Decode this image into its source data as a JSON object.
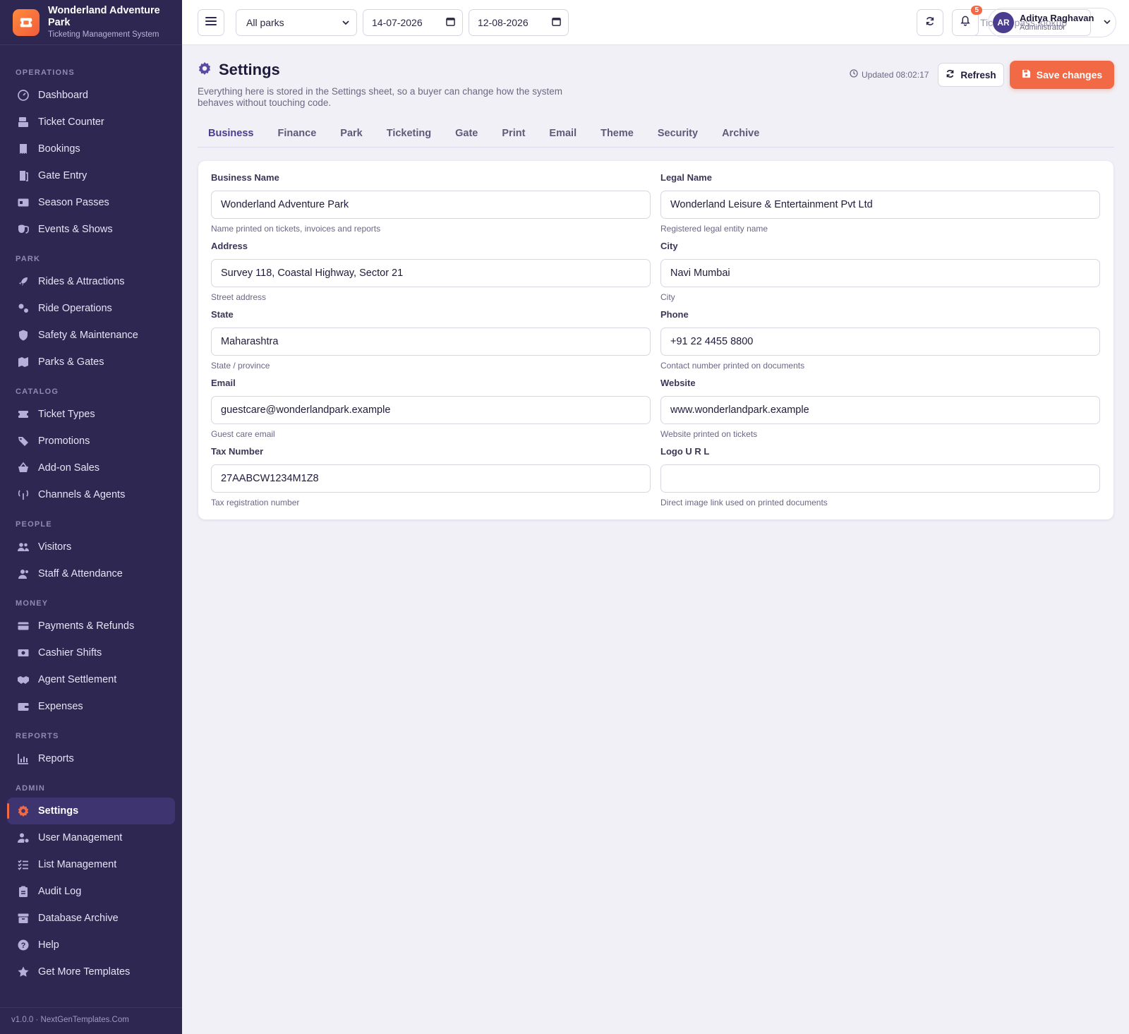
{
  "brand": {
    "name": "Wonderland Adventure Park",
    "subtitle": "Ticketing Management System"
  },
  "sidebar": {
    "sections": [
      {
        "title": "OPERATIONS",
        "items": [
          {
            "label": "Dashboard",
            "icon": "gauge-icon"
          },
          {
            "label": "Ticket Counter",
            "icon": "cash-register-icon"
          },
          {
            "label": "Bookings",
            "icon": "receipt-icon"
          },
          {
            "label": "Gate Entry",
            "icon": "door-icon"
          },
          {
            "label": "Season Passes",
            "icon": "id-card-icon"
          },
          {
            "label": "Events & Shows",
            "icon": "masks-icon"
          }
        ]
      },
      {
        "title": "PARK",
        "items": [
          {
            "label": "Rides & Attractions",
            "icon": "rocket-icon"
          },
          {
            "label": "Ride Operations",
            "icon": "gears-icon"
          },
          {
            "label": "Safety & Maintenance",
            "icon": "shield-icon"
          },
          {
            "label": "Parks & Gates",
            "icon": "map-icon"
          }
        ]
      },
      {
        "title": "CATALOG",
        "items": [
          {
            "label": "Ticket Types",
            "icon": "ticket-icon"
          },
          {
            "label": "Promotions",
            "icon": "tags-icon"
          },
          {
            "label": "Add-on Sales",
            "icon": "basket-icon"
          },
          {
            "label": "Channels & Agents",
            "icon": "antenna-icon"
          }
        ]
      },
      {
        "title": "PEOPLE",
        "items": [
          {
            "label": "Visitors",
            "icon": "users-icon"
          },
          {
            "label": "Staff & Attendance",
            "icon": "user-group-icon"
          }
        ]
      },
      {
        "title": "MONEY",
        "items": [
          {
            "label": "Payments & Refunds",
            "icon": "credit-card-icon"
          },
          {
            "label": "Cashier Shifts",
            "icon": "money-icon"
          },
          {
            "label": "Agent Settlement",
            "icon": "handshake-icon"
          },
          {
            "label": "Expenses",
            "icon": "wallet-icon"
          }
        ]
      },
      {
        "title": "REPORTS",
        "items": [
          {
            "label": "Reports",
            "icon": "bar-chart-icon"
          }
        ]
      },
      {
        "title": "ADMIN",
        "items": [
          {
            "label": "Settings",
            "icon": "gear-icon",
            "active": true
          },
          {
            "label": "User Management",
            "icon": "user-gear-icon"
          },
          {
            "label": "List Management",
            "icon": "list-check-icon"
          },
          {
            "label": "Audit Log",
            "icon": "clipboard-icon"
          },
          {
            "label": "Database Archive",
            "icon": "archive-icon"
          },
          {
            "label": "Help",
            "icon": "question-circle-icon"
          },
          {
            "label": "Get More Templates",
            "icon": "star-icon"
          }
        ]
      }
    ],
    "version": "v1.0.0 · NextGenTemplates.Com"
  },
  "topbar": {
    "park_select": "All parks",
    "date_from": "14-07-2026",
    "date_to": "12-08-2026",
    "search_placeholder": "Ticket / pass lookup",
    "notification_count": "5",
    "user": {
      "initials": "AR",
      "name": "Aditya Raghavan",
      "role": "Administrator"
    }
  },
  "page": {
    "title": "Settings",
    "description": "Everything here is stored in the Settings sheet, so a buyer can change how the system behaves without touching code.",
    "updated": "Updated 08:02:17",
    "refresh_label": "Refresh",
    "save_label": "Save changes",
    "tabs": [
      "Business",
      "Finance",
      "Park",
      "Ticketing",
      "Gate",
      "Print",
      "Email",
      "Theme",
      "Security",
      "Archive"
    ],
    "active_tab": "Business"
  },
  "form": {
    "fields": [
      {
        "label": "Business Name",
        "value": "Wonderland Adventure Park",
        "hint": "Name printed on tickets, invoices and reports"
      },
      {
        "label": "Legal Name",
        "value": "Wonderland Leisure & Entertainment Pvt Ltd",
        "hint": "Registered legal entity name"
      },
      {
        "label": "Address",
        "value": "Survey 118, Coastal Highway, Sector 21",
        "hint": "Street address"
      },
      {
        "label": "City",
        "value": "Navi Mumbai",
        "hint": "City"
      },
      {
        "label": "State",
        "value": "Maharashtra",
        "hint": "State / province"
      },
      {
        "label": "Phone",
        "value": "+91 22 4455 8800",
        "hint": "Contact number printed on documents"
      },
      {
        "label": "Email",
        "value": "guestcare@wonderlandpark.example",
        "hint": "Guest care email"
      },
      {
        "label": "Website",
        "value": "www.wonderlandpark.example",
        "hint": "Website printed on tickets"
      },
      {
        "label": "Tax Number",
        "value": "27AABCW1234M1Z8",
        "hint": "Tax registration number"
      },
      {
        "label": "Logo U R L",
        "value": "",
        "hint": "Direct image link used on printed documents"
      }
    ]
  },
  "colors": {
    "sidebar": "#2d2752",
    "accent": "#f26a45",
    "primary": "#4a3d8f"
  }
}
